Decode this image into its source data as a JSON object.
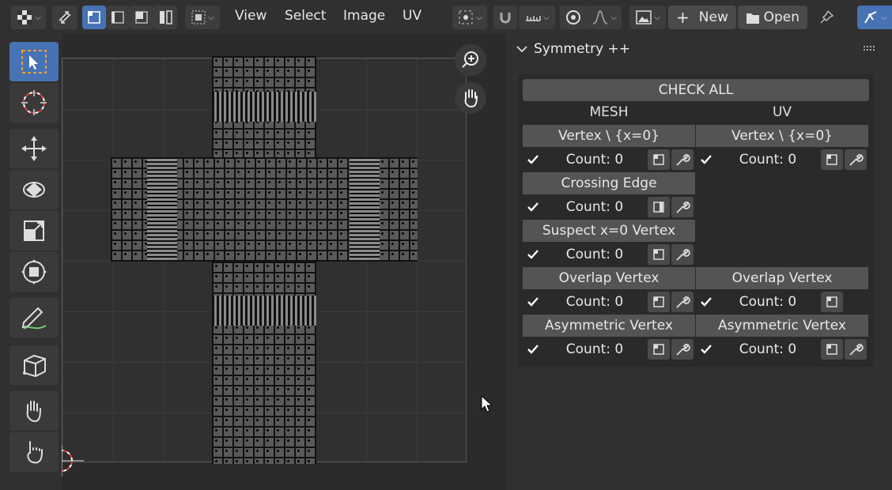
{
  "header": {
    "menus": [
      "View",
      "Select",
      "Image",
      "UV"
    ],
    "new_label": "New",
    "open_label": "Open"
  },
  "panel": {
    "title": "Symmetry ++",
    "check_all_label": "CHECK ALL",
    "mesh_label": "MESH",
    "uv_label": "UV",
    "mesh_checks": [
      {
        "name": "Vertex \\ {x=0}",
        "count": "Count: 0"
      },
      {
        "name": "Crossing Edge",
        "count": "Count: 0"
      },
      {
        "name": "Suspect x=0 Vertex",
        "count": "Count: 0"
      },
      {
        "name": "Overlap Vertex",
        "count": "Count: 0"
      },
      {
        "name": "Asymmetric Vertex",
        "count": "Count: 0"
      }
    ],
    "uv_checks": [
      {
        "name": "Vertex \\ {x=0}",
        "count": "Count: 0"
      },
      {
        "name": "Overlap Vertex",
        "count": "Count: 0"
      },
      {
        "name": "Asymmetric Vertex",
        "count": "Count: 0"
      }
    ]
  },
  "colors": {
    "accent": "#4772b3",
    "background": "#303030",
    "button": "#545454"
  }
}
